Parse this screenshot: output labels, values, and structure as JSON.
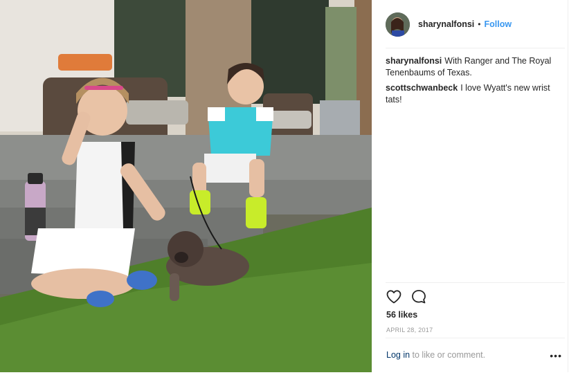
{
  "post": {
    "username": "sharynalfonsi",
    "separator": "•",
    "follow_label": "Follow",
    "comments": [
      {
        "user": "sharynalfonsi",
        "text": "With Ranger and The Royal Tenenbaums of Texas."
      },
      {
        "user": "scottschwanbeck",
        "text": "I love Wyatt's new wrist tats!"
      }
    ],
    "likes": "56 likes",
    "date": "APRIL 28, 2017",
    "login_link": "Log in",
    "login_suffix": " to like or comment.",
    "more_label": "•••"
  },
  "icons": {
    "like": "heart-icon",
    "comment": "comment-bubble-icon",
    "more": "more-options-icon"
  },
  "colors": {
    "accent": "#3897f0",
    "login_link": "#003569",
    "muted": "#999999"
  }
}
